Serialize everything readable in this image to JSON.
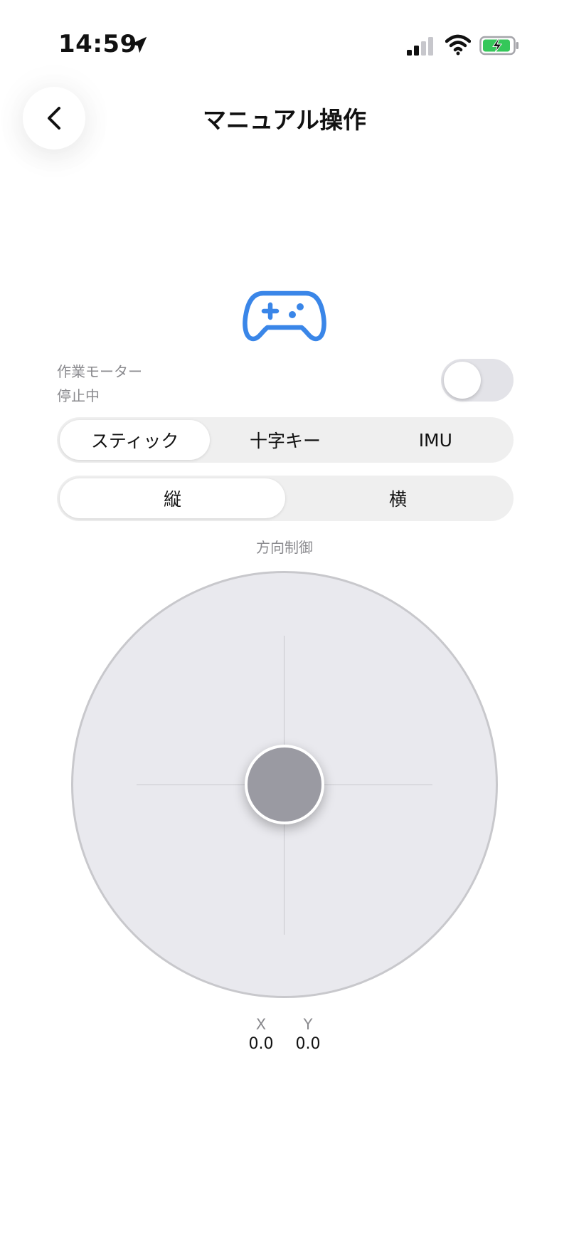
{
  "status_bar": {
    "time": "14:59",
    "icons": [
      "location-arrow-icon",
      "signal-icon",
      "wifi-icon",
      "battery-charging-icon"
    ]
  },
  "header": {
    "title": "マニュアル操作",
    "back_icon": "chevron-left-icon"
  },
  "gamepad": {
    "icon": "gamepad-icon",
    "color": "#3a86e8"
  },
  "motor": {
    "label": "作業モーター",
    "status": "停止中",
    "toggle_on": false
  },
  "mode_tabs": [
    {
      "label": "スティック",
      "active": true
    },
    {
      "label": "十字キー",
      "active": false
    },
    {
      "label": "IMU",
      "active": false
    }
  ],
  "axis_tabs": [
    {
      "label": "縦",
      "active": true
    },
    {
      "label": "横",
      "active": false
    }
  ],
  "direction_label": "方向制御",
  "coordinates": {
    "x_label": "X",
    "y_label": "Y",
    "x_value": "0.0",
    "y_value": "0.0"
  },
  "colors": {
    "accent": "#3a86e8",
    "pad_fill": "#e9e9ee",
    "knob_fill": "#9a9aa2",
    "segment_bg": "#efefef"
  }
}
